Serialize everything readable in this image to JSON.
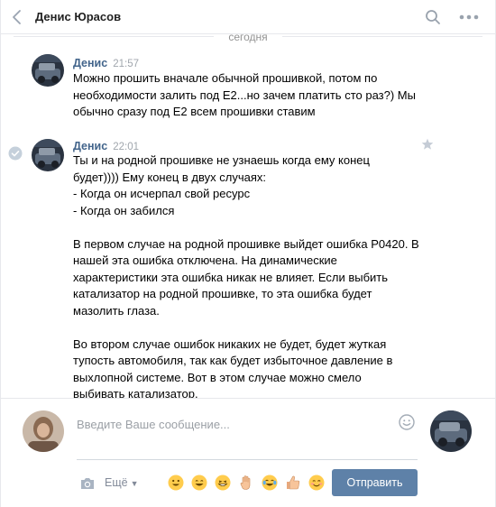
{
  "header": {
    "title": "Денис Юрасов",
    "icons": [
      "back-icon",
      "search-icon",
      "more-icon"
    ]
  },
  "date_divider": "сегодня",
  "messages": [
    {
      "author": "Денис",
      "time": "21:57",
      "lines": [
        "Можно прошить вначале обычной прошивкой, потом по",
        "необходимости залить под Е2...но зачем платить сто раз?) Мы",
        "обычно сразу под Е2 всем прошивки ставим"
      ]
    },
    {
      "author": "Денис",
      "time": "22:01",
      "lines": [
        "Ты и на родной прошивке не узнаешь когда ему конец",
        "будет)))) Ему конец в двух случаях:",
        "- Когда он исчерпал свой ресурс",
        "- Когда он забился",
        "",
        "В первом случае на родной прошивке выйдет ошибка Р0420. В",
        "нашей эта ошибка отключена. На динамические",
        "характеристики эта ошибка никак не влияет. Если выбить",
        "катализатор на родной прошивке, то эта ошибка будет",
        "мазолить глаза.",
        "",
        "Во втором случае ошибок никаких не будет, будет жуткая",
        "тупость автомобиля, так как будет избыточное давление в",
        "выхлопной системе. Вот в этом случае можно смело",
        "выбивать катализатор."
      ]
    }
  ],
  "composer": {
    "placeholder": "Введите Ваше сообщение...",
    "more_label": "Ещё",
    "send_label": "Отправить",
    "emojis": [
      "😀",
      "😄",
      "😁",
      "✋",
      "😂",
      "👍",
      "😊"
    ]
  },
  "colors": {
    "accent": "#5e81a8",
    "author": "#42648b",
    "muted": "#939393",
    "divider": "#e7e8ec"
  }
}
